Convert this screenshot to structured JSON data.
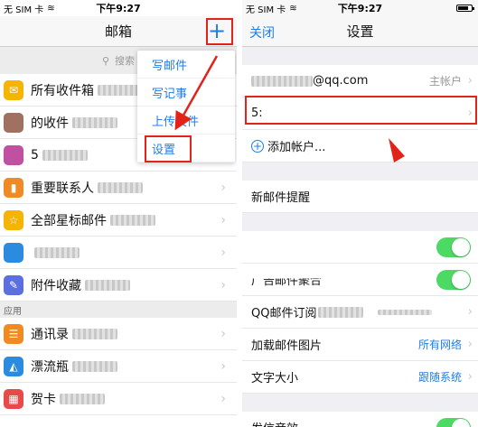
{
  "status": {
    "carrier": "无 SIM 卡",
    "time": "下午9:27"
  },
  "left": {
    "title": "邮箱",
    "plus_label": "+",
    "search_placeholder": "搜索",
    "rows": [
      {
        "label": "所有收件箱",
        "icon": "inbox-icon",
        "color": "#f5b400",
        "glyph": "✉"
      },
      {
        "label": "的收件",
        "icon": "avatar",
        "color": "#a07060",
        "glyph": ""
      },
      {
        "label": "5",
        "icon": "avatar",
        "color": "#c050a0",
        "glyph": ""
      },
      {
        "label": "重要联系人",
        "icon": "bookmark-icon",
        "color": "#f08a24",
        "glyph": "▮"
      },
      {
        "label": "全部星标邮件",
        "icon": "star-icon",
        "color": "#f5b400",
        "glyph": "☆"
      },
      {
        "label": "",
        "icon": "folder-icon",
        "color": "#2a8be0",
        "glyph": ""
      },
      {
        "label": "附件收藏",
        "icon": "attachment-icon",
        "color": "#5b6fe0",
        "glyph": "✎"
      }
    ],
    "section_label": "应用",
    "app_rows": [
      {
        "label": "通讯录",
        "icon": "contacts-icon",
        "color": "#f08a24",
        "glyph": "☰"
      },
      {
        "label": "漂流瓶",
        "icon": "bottle-icon",
        "color": "#2a8be0",
        "glyph": "◭"
      },
      {
        "label": "贺卡",
        "icon": "card-icon",
        "color": "#e84a4a",
        "glyph": "▦"
      }
    ],
    "menu": [
      "写邮件",
      "写记事",
      "上传文件",
      "设置"
    ]
  },
  "right": {
    "close_label": "关闭",
    "title": "设置",
    "account_suffix": "@qq.com",
    "account_tag": "主帐户",
    "account2_prefix": "5:",
    "add_account": "添加帐户...",
    "new_mail_alert": "新邮件提醒",
    "ad_mail_partial": "广告邮件聚合",
    "subscription": "QQ邮件订阅",
    "load_images": "加载邮件图片",
    "load_images_value": "所有网络",
    "font_size": "文字大小",
    "font_size_value": "跟随系统",
    "send_sound": "发信音效"
  }
}
